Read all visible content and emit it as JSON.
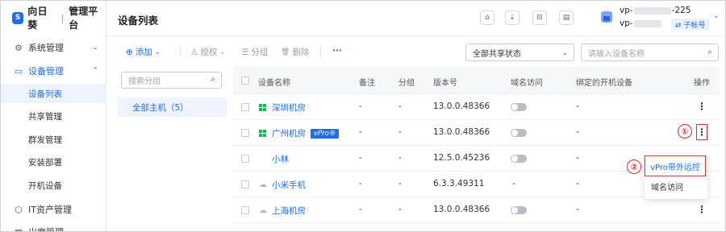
{
  "app": {
    "logo_mark": "S",
    "brand": "向日葵",
    "separator": "|",
    "subtitle": "管理平台"
  },
  "sidebar": {
    "items": [
      {
        "label": "系统管理",
        "icon": "gear-icon",
        "glyph": "⚙",
        "chevron": "⌄"
      },
      {
        "label": "设备管理",
        "icon": "monitor-icon",
        "glyph": "▭",
        "chevron": "⌃",
        "active": true
      },
      {
        "label": "IT资产管理",
        "icon": "chip-icon",
        "glyph": "⬡"
      },
      {
        "label": "出席管理",
        "icon": "calendar-icon",
        "glyph": "▦"
      }
    ],
    "subitems": [
      {
        "label": "设备列表",
        "selected": true
      },
      {
        "label": "共享管理"
      },
      {
        "label": "群发管理"
      },
      {
        "label": "安装部署"
      },
      {
        "label": "开机设备"
      }
    ]
  },
  "header": {
    "title": "设备列表",
    "icons": [
      "home-icon",
      "download-icon",
      "window-icon",
      "clipboard-icon"
    ],
    "glyphs": [
      "⌂",
      "⇣",
      "⊟",
      "▤"
    ],
    "user": {
      "line1_prefix": "vp-",
      "line1_suffix": "-225",
      "line2_prefix": "vp-",
      "sub_account": "⇄ 子帐号",
      "chevron": "⌄"
    }
  },
  "toolbar": {
    "add": "添加",
    "add_icon": "⊕",
    "add_chevron": "⌄",
    "authorize": "授权",
    "authorize_icon": "♙",
    "authorize_chevron": "⌄",
    "group": "分组",
    "group_icon": "☰",
    "delete": "删除",
    "delete_icon": "🗑",
    "more": "···",
    "share_filter": "全部共享状态",
    "share_chevron": "⌄",
    "search_placeholder": "请输入设备名称",
    "search_icon": "⌕"
  },
  "groups": {
    "search_placeholder": "搜索分组",
    "search_icon": "⌕",
    "all_hosts": "全部主机（5）"
  },
  "table": {
    "columns": [
      "设备名称",
      "备注",
      "分组",
      "版本号",
      "域名访问",
      "绑定的开机设备",
      "操作"
    ],
    "rows": [
      {
        "name": "深圳机房",
        "os": "windows",
        "note": "-",
        "group": "-",
        "version": "13.0.0.48366",
        "domain_access": false,
        "bound": "-",
        "action": "⋮"
      },
      {
        "name": "广州机房",
        "os": "windows",
        "badge": "vPro®",
        "note": "-",
        "group": "-",
        "version": "13.0.0.48366",
        "domain_access": false,
        "bound": "-",
        "action": "⋮"
      },
      {
        "name": "小林",
        "os": "apple",
        "note": "-",
        "group": "-",
        "version": "12.5.0.45236",
        "domain_access": false,
        "bound": "-",
        "action": ""
      },
      {
        "name": "小米手机",
        "os": "android",
        "note": "-",
        "group": "-",
        "version": "6.3.3.49311",
        "domain_access": null,
        "bound": "-",
        "action": ""
      },
      {
        "name": "上海机房",
        "os": "linux",
        "note": "-",
        "group": "-",
        "version": "13.0.0.48366",
        "domain_access": false,
        "bound": "-",
        "action": "⋮"
      }
    ],
    "os_glyphs": {
      "apple": "",
      "android": "☁",
      "linux": "☁"
    }
  },
  "dropdown": {
    "options": [
      "vPro带外远控",
      "域名访问"
    ]
  },
  "callouts": [
    "①",
    "②"
  ],
  "colors": {
    "accent": "#1e6cf0",
    "highlight": "#e0302f",
    "windows_green": "#1fb55b"
  }
}
